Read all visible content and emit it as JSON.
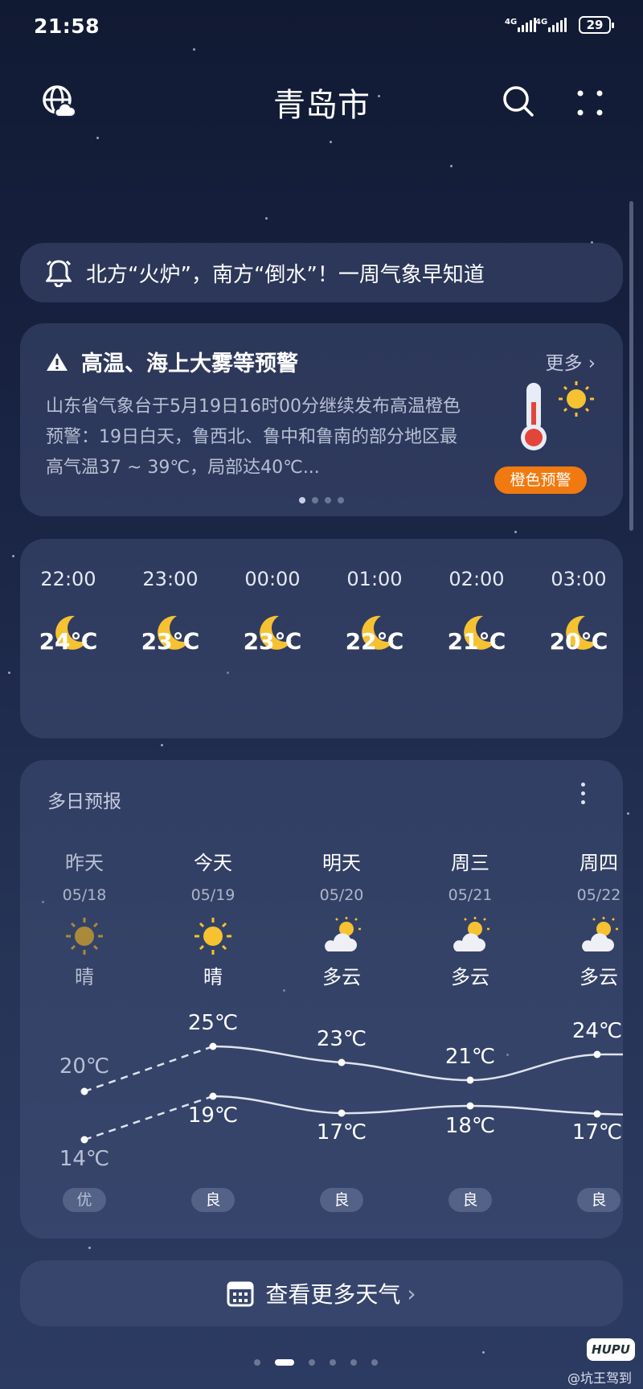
{
  "status_bar": {
    "time": "21:58",
    "network_1": "4G",
    "network_2": "4G",
    "battery": "29"
  },
  "header": {
    "city": "青岛市",
    "left_icon": "globe-cloud-icon",
    "search_icon": "search-icon",
    "menu_icon": "more-icon"
  },
  "news": {
    "icon": "bell-icon",
    "text": "北方“火炉”，南方“倒水”！一周气象早知道"
  },
  "alert": {
    "icon": "warning-icon",
    "title": "高温、海上大雾等预警",
    "more_label": "更多",
    "body": "山东省气象台于5月19日16时00分继续发布高温橙色预警：19日白天，鲁西北、鲁中和鲁南的部分地区最高气温37 ~ 39℃，局部达40℃...",
    "badge": "橙色预警",
    "badge_color": "#f07a0f",
    "page_count": 4,
    "active_page": 1
  },
  "hourly": [
    {
      "time": "22:00",
      "icon": "moon-icon",
      "temp": "24℃"
    },
    {
      "time": "23:00",
      "icon": "moon-icon",
      "temp": "23℃"
    },
    {
      "time": "00:00",
      "icon": "moon-icon",
      "temp": "23℃"
    },
    {
      "time": "01:00",
      "icon": "moon-icon",
      "temp": "22℃"
    },
    {
      "time": "02:00",
      "icon": "moon-icon",
      "temp": "21℃"
    },
    {
      "time": "03:00",
      "icon": "moon-icon",
      "temp": "20℃"
    }
  ],
  "daily": {
    "title": "多日预报",
    "days": [
      {
        "name": "昨天",
        "date": "05/18",
        "icon": "sun-icon",
        "cond": "晴",
        "high": "20℃",
        "low": "14℃",
        "aqi": "优"
      },
      {
        "name": "今天",
        "date": "05/19",
        "icon": "sun-icon",
        "cond": "晴",
        "high": "25℃",
        "low": "19℃",
        "aqi": "良"
      },
      {
        "name": "明天",
        "date": "05/20",
        "icon": "partly-cloudy-icon",
        "cond": "多云",
        "high": "23℃",
        "low": "17℃",
        "aqi": "良"
      },
      {
        "name": "周三",
        "date": "05/21",
        "icon": "partly-cloudy-icon",
        "cond": "多云",
        "high": "21℃",
        "low": "18℃",
        "aqi": "良"
      },
      {
        "name": "周四",
        "date": "05/22",
        "icon": "partly-cloudy-icon",
        "cond": "多云",
        "high": "24℃",
        "low": "17℃",
        "aqi": "良"
      }
    ]
  },
  "more_weather": {
    "label": "查看更多天气",
    "icon": "calendar-icon"
  },
  "page_indicator": {
    "count": 6,
    "active": 1
  },
  "watermark": {
    "logo": "HUPU",
    "text": "@坑王驾到"
  },
  "colors": {
    "accent_orange": "#f07a0f",
    "moon": "#f6c232",
    "sun": "#f6c232"
  }
}
